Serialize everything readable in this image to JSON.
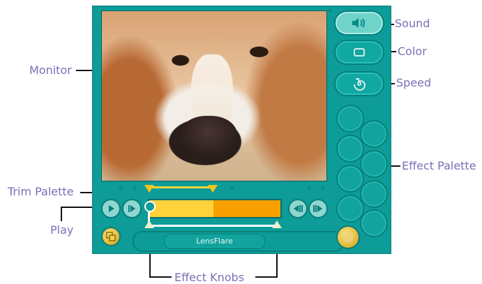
{
  "callouts": {
    "sound": "Sound",
    "color": "Color",
    "speed": "Speed",
    "monitor": "Monitor",
    "effect_palette": "Effect Palette",
    "trim_palette": "Trim Palette",
    "play": "Play",
    "effect_knobs": "Effect Knobs"
  },
  "effect": {
    "name": "LensFlare"
  },
  "timeline": {
    "played_fraction": 0.49
  },
  "colors": {
    "panel": "#0d9c97",
    "callout_text": "#7a6fb8",
    "timeline_played": "#fdd23a",
    "timeline_rest": "#f7a000",
    "gold": "#f3c41e"
  },
  "icons": {
    "sound": "speaker-icon",
    "color": "square-icon",
    "speed": "spiral-icon",
    "play": "play-icon",
    "step": "step-forward-icon",
    "rewind": "rewind-icon",
    "fast_forward": "fast-forward-icon",
    "clip": "clip-copy-icon",
    "clear": "clear-effect-icon"
  }
}
